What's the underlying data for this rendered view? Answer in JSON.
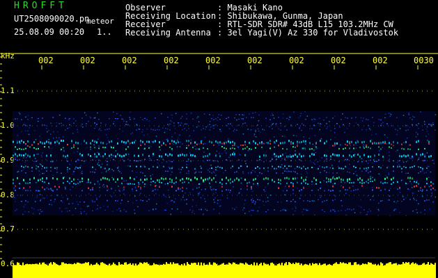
{
  "header": {
    "logo": "HROFFT",
    "filename": "UT2508090020.pn",
    "mode": "meteor",
    "datetime": "25.08.09 00:20",
    "frame": "1.."
  },
  "info": {
    "labels": [
      "Observer",
      "Receiving Location",
      "Receiver",
      "Receiving Antenna"
    ],
    "values": [
      ": Masaki Kano",
      ": Shibukawa, Gunma, Japan",
      ": RTL-SDR SDR# 43dB L15 103.2MHz CW",
      ": 3el Yagi(V) Az 330 for Vladivostok"
    ]
  },
  "axis": {
    "unit": "kHz",
    "y_ticks": [
      "1.1",
      "1.0",
      "0.9",
      "0.8",
      "0.7",
      "0.6"
    ],
    "x_ticks": [
      "002",
      "002",
      "002",
      "002",
      "002",
      "002",
      "002",
      "002",
      "002",
      "0030"
    ]
  },
  "colors": {
    "grid": "#ffff3a",
    "text": "#ffffff",
    "logo": "#2fd62f",
    "noise_bar": "#ffff00"
  }
}
